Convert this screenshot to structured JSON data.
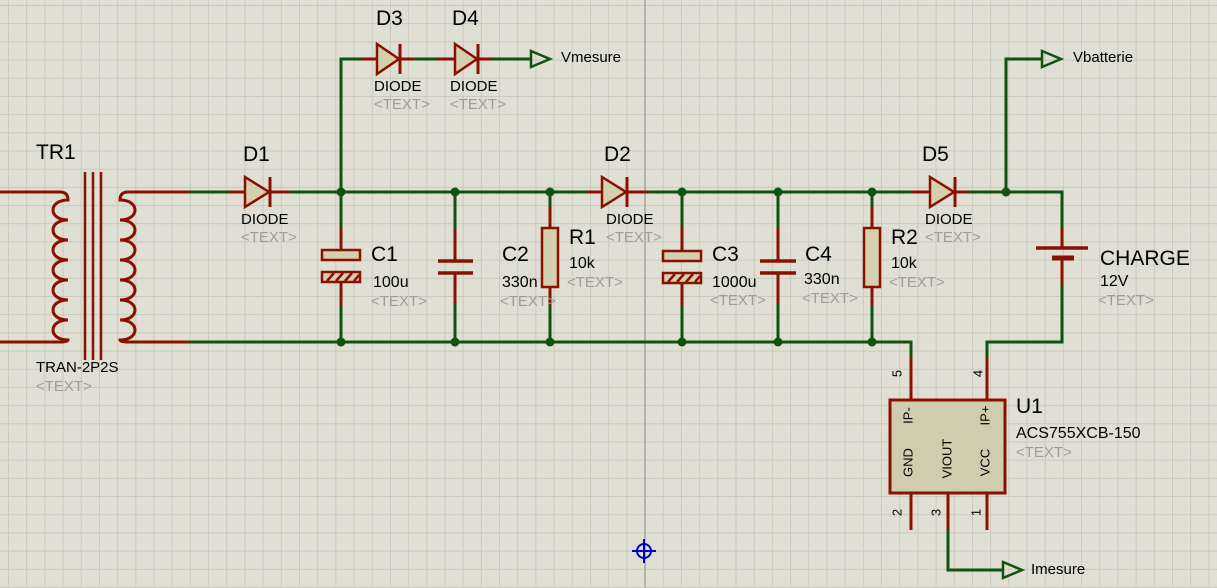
{
  "editor": {
    "canvas": "schematic-sheet",
    "origin_marker": "origin-crosshair"
  },
  "colors": {
    "background": "#dfdfd3",
    "grid": "#c9c9bc",
    "wire_green": "#125112",
    "component_red": "#8a1004",
    "body_fill": "#d3d0ae",
    "muted_text": "#9e9e96",
    "origin_blue": "#0000c2"
  },
  "components": {
    "TR1": {
      "ref": "TR1",
      "model": "TRAN-2P2S",
      "prop": "<TEXT>"
    },
    "D1": {
      "ref": "D1",
      "model": "DIODE",
      "prop": "<TEXT>"
    },
    "D2": {
      "ref": "D2",
      "model": "DIODE",
      "prop": "<TEXT>"
    },
    "D3": {
      "ref": "D3",
      "model": "DIODE",
      "prop": "<TEXT>"
    },
    "D4": {
      "ref": "D4",
      "model": "DIODE",
      "prop": "<TEXT>"
    },
    "D5": {
      "ref": "D5",
      "model": "DIODE",
      "prop": "<TEXT>"
    },
    "C1": {
      "ref": "C1",
      "value": "100u",
      "prop": "<TEXT>"
    },
    "C2": {
      "ref": "C2",
      "value": "330n",
      "prop": "<TEXT>"
    },
    "C3": {
      "ref": "C3",
      "value": "1000u",
      "prop": "<TEXT>"
    },
    "C4": {
      "ref": "C4",
      "value": "330n",
      "prop": "<TEXT>"
    },
    "R1": {
      "ref": "R1",
      "value": "10k",
      "prop": "<TEXT>"
    },
    "R2": {
      "ref": "R2",
      "value": "10k",
      "prop": "<TEXT>"
    },
    "BAT": {
      "ref": "CHARGE",
      "value": "12V",
      "prop": "<TEXT>"
    },
    "U1": {
      "ref": "U1",
      "model": "ACS755XCB-150",
      "prop": "<TEXT>",
      "pins": [
        {
          "num": "5",
          "name": "IP-"
        },
        {
          "num": "4",
          "name": "IP+"
        },
        {
          "num": "2",
          "name": "GND"
        },
        {
          "num": "3",
          "name": "VIOUT"
        },
        {
          "num": "1",
          "name": "VCC"
        }
      ]
    }
  },
  "terminals": {
    "vmesure": {
      "label": "Vmesure"
    },
    "vbatterie": {
      "label": "Vbatterie"
    },
    "imesure": {
      "label": "Imesure"
    }
  }
}
